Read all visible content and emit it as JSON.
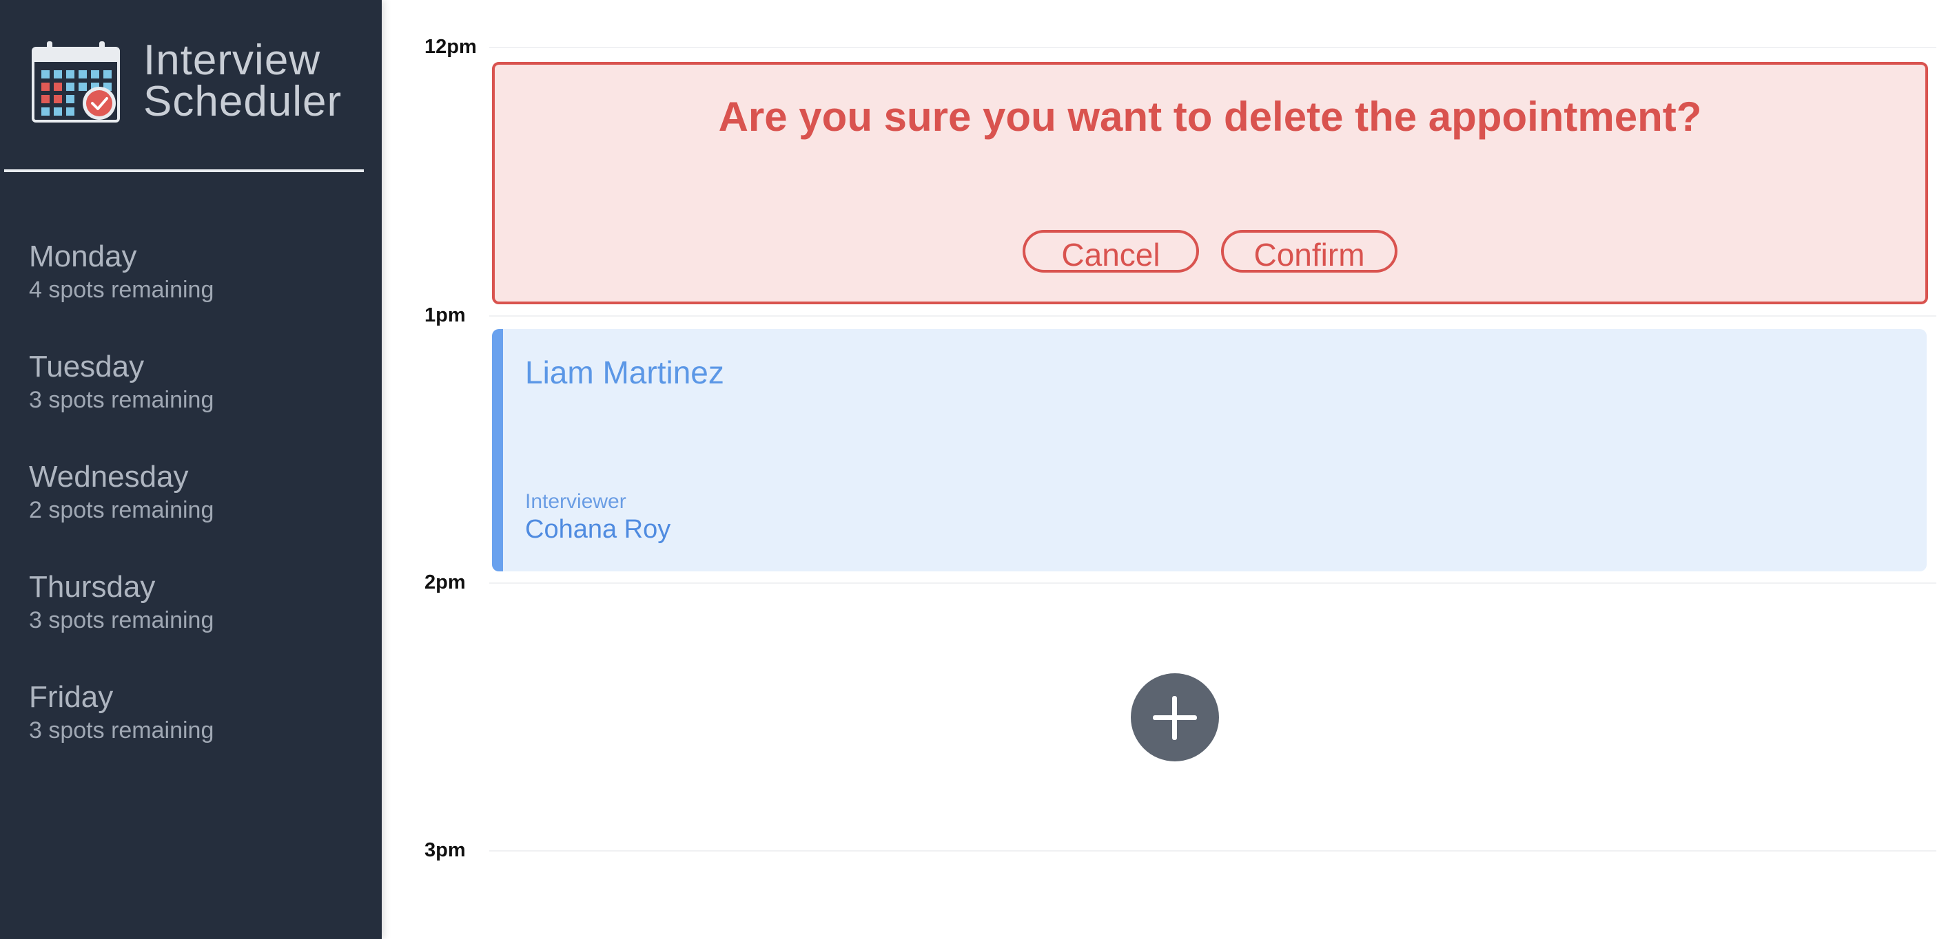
{
  "app": {
    "title_line1": "Interview",
    "title_line2": "Scheduler"
  },
  "sidebar": {
    "days": [
      {
        "name": "Monday",
        "spots": "4 spots remaining"
      },
      {
        "name": "Tuesday",
        "spots": "3 spots remaining"
      },
      {
        "name": "Wednesday",
        "spots": "2 spots remaining"
      },
      {
        "name": "Thursday",
        "spots": "3 spots remaining"
      },
      {
        "name": "Friday",
        "spots": "3 spots remaining"
      }
    ]
  },
  "schedule": {
    "hours": [
      "12pm",
      "1pm",
      "2pm",
      "3pm"
    ],
    "confirm": {
      "message": "Are you sure you want to delete the appointment?",
      "cancel_label": "Cancel",
      "confirm_label": "Confirm"
    },
    "appointment": {
      "student": "Liam Martinez",
      "interviewer_label": "Interviewer",
      "interviewer_name": "Cohana Roy"
    },
    "add_icon": "plus-icon"
  },
  "colors": {
    "sidebar_bg": "#252e3d",
    "danger": "#d9534f",
    "danger_bg": "#fae5e4",
    "appointment_accent": "#69a1ee",
    "appointment_bg": "#e6f0fc",
    "add_button": "#5c6470"
  }
}
